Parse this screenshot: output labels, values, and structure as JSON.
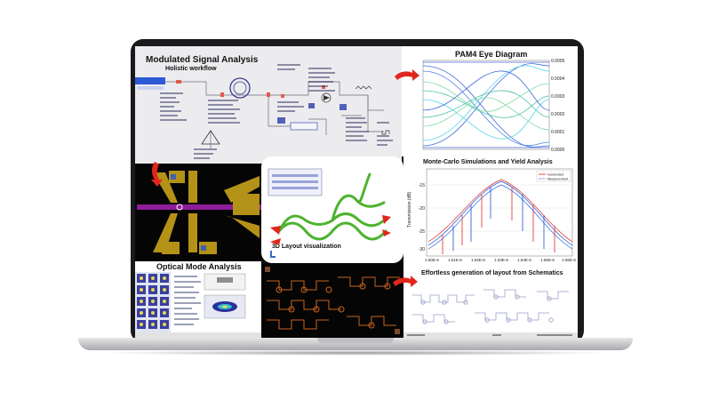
{
  "schematic": {
    "title": "Modulated Signal Analysis",
    "subtitle": "Holistic workflow"
  },
  "eye_diagram": {
    "title": "PAM4 Eye Diagram",
    "yticks": [
      "0.0000",
      "0.0001",
      "0.0002",
      "0.0003",
      "0.0004",
      "0.0005"
    ]
  },
  "mask_layout": {},
  "layout_3d": {
    "title": "3D Layout visualization"
  },
  "monte_carlo": {
    "title": "Monte-Carlo Simulations and Yield Analysis",
    "ylabel": "Transmission (dB)",
    "yticks": [
      "-15",
      "-20",
      "-25",
      "-30"
    ],
    "xticks": [
      "1.50E-6",
      "1.51E-6",
      "1.52E-6",
      "1.53E-6",
      "1.54E-6",
      "1.55E-6",
      "1.56E-6"
    ],
    "legend": [
      "Generated",
      "Measurement"
    ]
  },
  "mode_analysis": {
    "title": "Optical Mode Analysis"
  },
  "layout_gen": {
    "title": "Effortless generation of layout from Schematics"
  },
  "colors": {
    "red_arrow": "#e1261c",
    "waveguide_green": "#4db32e",
    "eye_blue": "#1f4fd6",
    "eye_cyan": "#35d0e0",
    "mask_yellow": "#c8a21a",
    "layout_orange": "#c8641e"
  }
}
